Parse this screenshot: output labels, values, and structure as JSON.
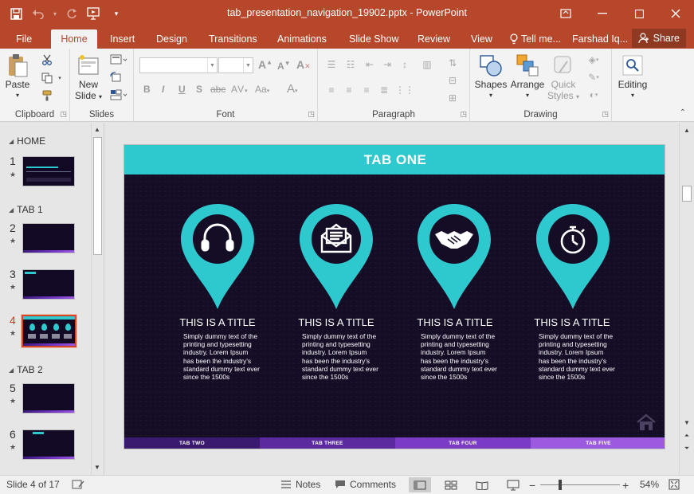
{
  "window": {
    "title": "tab_presentation_navigation_19902.pptx - PowerPoint",
    "accent": "#b7472a"
  },
  "ribbon_tabs": [
    {
      "label": "File"
    },
    {
      "label": "Home"
    },
    {
      "label": "Insert"
    },
    {
      "label": "Design"
    },
    {
      "label": "Transitions"
    },
    {
      "label": "Animations"
    },
    {
      "label": "Slide Show"
    },
    {
      "label": "Review"
    },
    {
      "label": "View"
    }
  ],
  "tell_me": "Tell me...",
  "user": "Farshad Iq...",
  "share_label": "Share",
  "ribbon": {
    "clipboard": {
      "label": "Clipboard",
      "paste": "Paste"
    },
    "slides": {
      "label": "Slides",
      "new_slide_1": "New",
      "new_slide_2": "Slide"
    },
    "font": {
      "label": "Font"
    },
    "paragraph": {
      "label": "Paragraph"
    },
    "drawing": {
      "label": "Drawing",
      "shapes": "Shapes",
      "arrange": "Arrange",
      "quick_styles_1": "Quick",
      "quick_styles_2": "Styles"
    },
    "editing": {
      "label": "Editing"
    }
  },
  "thumbnails": {
    "sections": [
      {
        "name": "HOME"
      },
      {
        "name": "TAB 1"
      },
      {
        "name": "TAB 2"
      }
    ],
    "slides": [
      {
        "num": "1"
      },
      {
        "num": "2"
      },
      {
        "num": "3"
      },
      {
        "num": "4",
        "selected": true
      },
      {
        "num": "5"
      },
      {
        "num": "6"
      }
    ]
  },
  "slide": {
    "header": "TAB ONE",
    "header_color": "#2ec9cf",
    "background_color": "#150c26",
    "pins": [
      {
        "icon": "headphones-icon",
        "title": "THIS IS A TITLE",
        "text": "Simply dummy text of the printing and typesetting industry. Lorem Ipsum has been the industry's standard dummy text ever since the 1500s"
      },
      {
        "icon": "envelope-icon",
        "title": "THIS IS A TITLE",
        "text": "Simply dummy text of the printing and typesetting industry. Lorem Ipsum has been the industry's standard dummy text ever since the 1500s"
      },
      {
        "icon": "handshake-icon",
        "title": "THIS IS A TITLE",
        "text": "Simply dummy text of the printing and typesetting industry. Lorem Ipsum has been the industry's standard dummy text ever since the 1500s"
      },
      {
        "icon": "stopwatch-icon",
        "title": "THIS IS A TITLE",
        "text": "Simply dummy text of the printing and typesetting industry. Lorem Ipsum has been the industry's standard dummy text ever since the 1500s"
      }
    ],
    "nav_tabs": [
      {
        "label": "TAB TWO",
        "color": "#3a1a6e"
      },
      {
        "label": "TAB THREE",
        "color": "#5a2a9e"
      },
      {
        "label": "TAB FOUR",
        "color": "#7a3cc4"
      },
      {
        "label": "TAB FIVE",
        "color": "#9b5adf"
      }
    ]
  },
  "status": {
    "slide_info": "Slide 4 of 17",
    "notes": "Notes",
    "comments": "Comments",
    "zoom": "54%",
    "zoom_minus": "−",
    "zoom_plus": "+"
  }
}
